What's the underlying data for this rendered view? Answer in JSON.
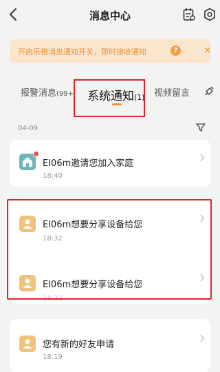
{
  "header": {
    "title": "消息中心"
  },
  "banner": {
    "text": "开启乐橙消息通知开关，即时接收通知",
    "help_glyph": "?",
    "close_glyph": "×"
  },
  "tabs": {
    "alarm": {
      "label": "报警消息",
      "count": "(99+"
    },
    "system": {
      "label": "系统通知",
      "count": "(1)"
    },
    "video": {
      "label": "视频留言"
    }
  },
  "date_group": "04-09",
  "messages": [
    {
      "title": "EI06m邀请您加入家庭",
      "time": "18:40",
      "icon": "home-icon",
      "unread": true
    },
    {
      "title": "EI06m想要分享设备给您",
      "time": "18:32",
      "icon": "user-icon",
      "unread": false
    },
    {
      "title": "EI06m想要分享设备给您",
      "time": "18:32",
      "icon": "user-icon",
      "unread": false
    },
    {
      "title": "您有新的好友申请",
      "time": "18:19",
      "icon": "user-icon",
      "unread": false
    }
  ],
  "colors": {
    "accent": "#e7943a",
    "banner_bg": "#fbe5cd",
    "highlight": "#e0242a",
    "home_icon": "#6fb6b8",
    "user_icon": "#f1c27d"
  }
}
